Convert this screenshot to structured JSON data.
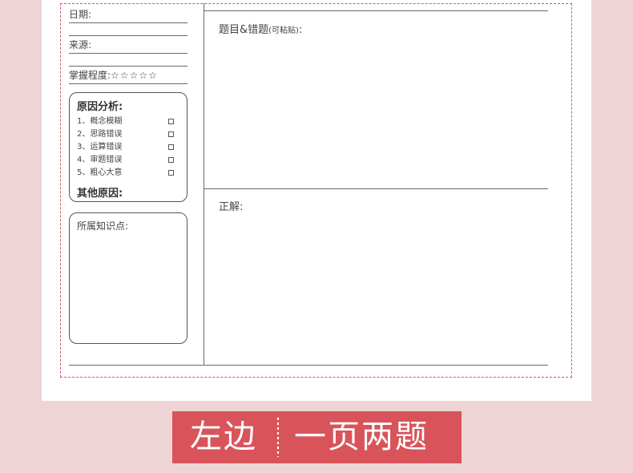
{
  "fields": {
    "date": "日期:",
    "source": "来源:",
    "mastery_label": "掌握程度:",
    "mastery_stars": "☆☆☆☆☆"
  },
  "causes": {
    "title": "原因分析:",
    "items": [
      "1、概念模糊",
      "2、思路错误",
      "3、运算错误",
      "4、审题错误",
      "5、粗心大意"
    ],
    "checkbox": "☐",
    "other": "其他原因:"
  },
  "knowledge": {
    "title": "所属知识点:"
  },
  "question": {
    "label": "题目&错题",
    "note": "(可粘贴)",
    "colon": ":"
  },
  "answer": {
    "label": "正解:"
  },
  "banner": {
    "left": "左边",
    "right": "一页两题"
  },
  "colors": {
    "background": "#efd4d6",
    "dash": "#e05060",
    "banner": "#d9545a"
  }
}
